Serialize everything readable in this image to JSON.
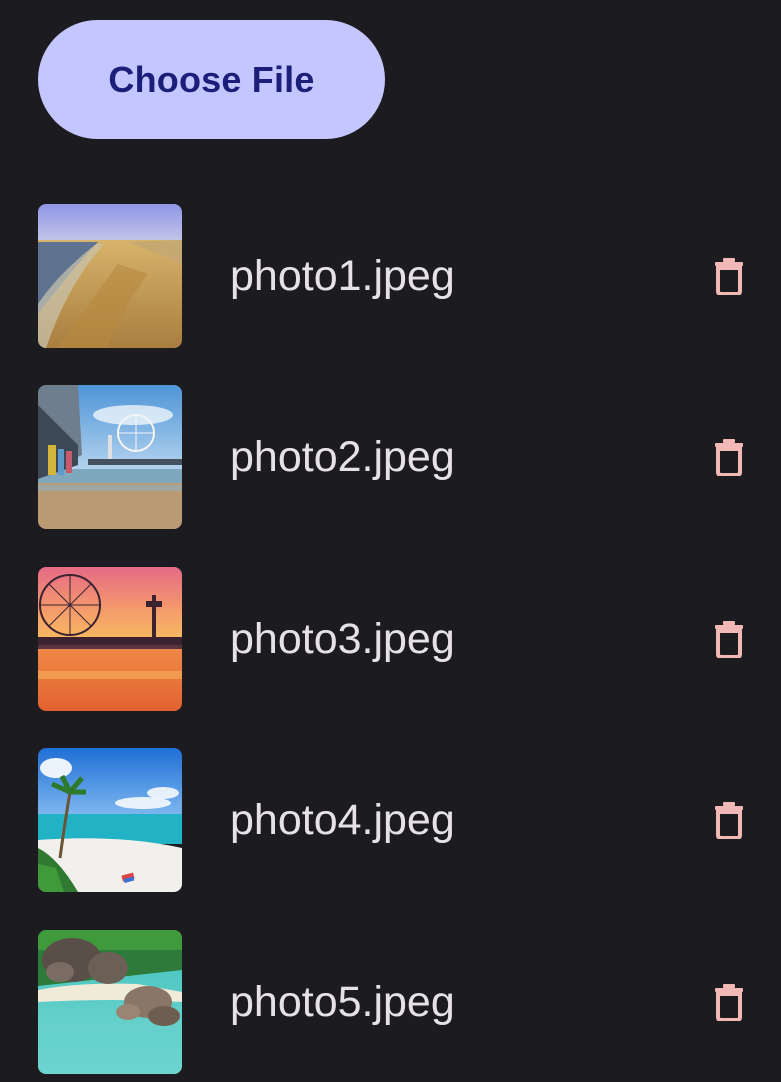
{
  "choose_button": {
    "label": "Choose File"
  },
  "colors": {
    "background": "#1c1b1f",
    "button_bg": "#c4c6ff",
    "button_text": "#1c1f7a",
    "filename_text": "#e6e1e5",
    "delete_icon": "#f2b8b5"
  },
  "files": [
    {
      "name": "photo1.jpeg",
      "thumbnail": "beach-shoreline-image",
      "action_icon": "trash-icon"
    },
    {
      "name": "photo2.jpeg",
      "thumbnail": "pier-ferris-wheel-image",
      "action_icon": "trash-icon"
    },
    {
      "name": "photo3.jpeg",
      "thumbnail": "sunset-pier-ferris-wheel-image",
      "action_icon": "trash-icon"
    },
    {
      "name": "photo4.jpeg",
      "thumbnail": "tropical-beach-palm-image",
      "action_icon": "trash-icon"
    },
    {
      "name": "photo5.jpeg",
      "thumbnail": "rocky-lagoon-image",
      "action_icon": "trash-icon"
    }
  ]
}
